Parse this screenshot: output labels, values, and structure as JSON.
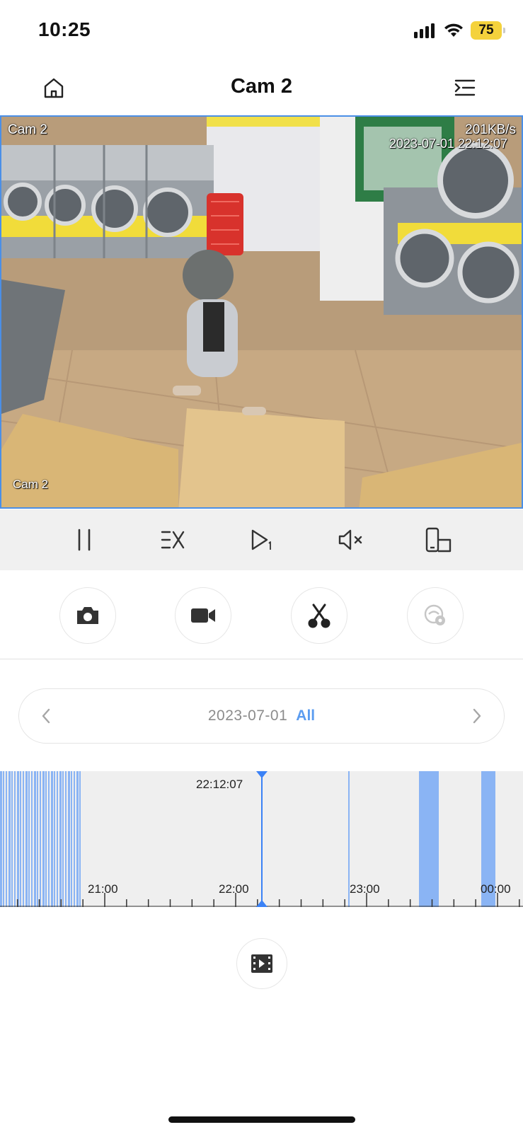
{
  "status_bar": {
    "time": "10:25",
    "battery": "75",
    "battery_color": "#f4d23c"
  },
  "nav": {
    "title": "Cam 2",
    "home_icon": "home-icon",
    "menu_icon": "menu-indent-icon"
  },
  "video": {
    "osd_top_left": "Cam 2",
    "osd_bottom_left": "Cam 2",
    "bitrate": "201KB/s",
    "timestamp": "2023-07-01 22:12:07"
  },
  "controls": [
    {
      "icon": "pause-icon"
    },
    {
      "icon": "speed-icon"
    },
    {
      "icon": "play-frame-icon"
    },
    {
      "icon": "mute-icon"
    },
    {
      "icon": "rotate-screen-icon"
    }
  ],
  "actions": [
    {
      "icon": "camera-icon",
      "enabled": true
    },
    {
      "icon": "video-record-icon",
      "enabled": true
    },
    {
      "icon": "scissors-icon",
      "enabled": true
    },
    {
      "icon": "eye-search-icon",
      "enabled": false
    }
  ],
  "date_selector": {
    "date": "2023-07-01",
    "filter": "All",
    "accent": "#5b9cf0"
  },
  "timeline": {
    "cursor_time": "22:12:07",
    "hour_labels": [
      "21:00",
      "22:00",
      "23:00",
      "00:00"
    ],
    "recording_color": "#8ab4f4",
    "cursor_color": "#3b82f6"
  },
  "bottom": {
    "clips_icon": "film-clips-icon"
  }
}
